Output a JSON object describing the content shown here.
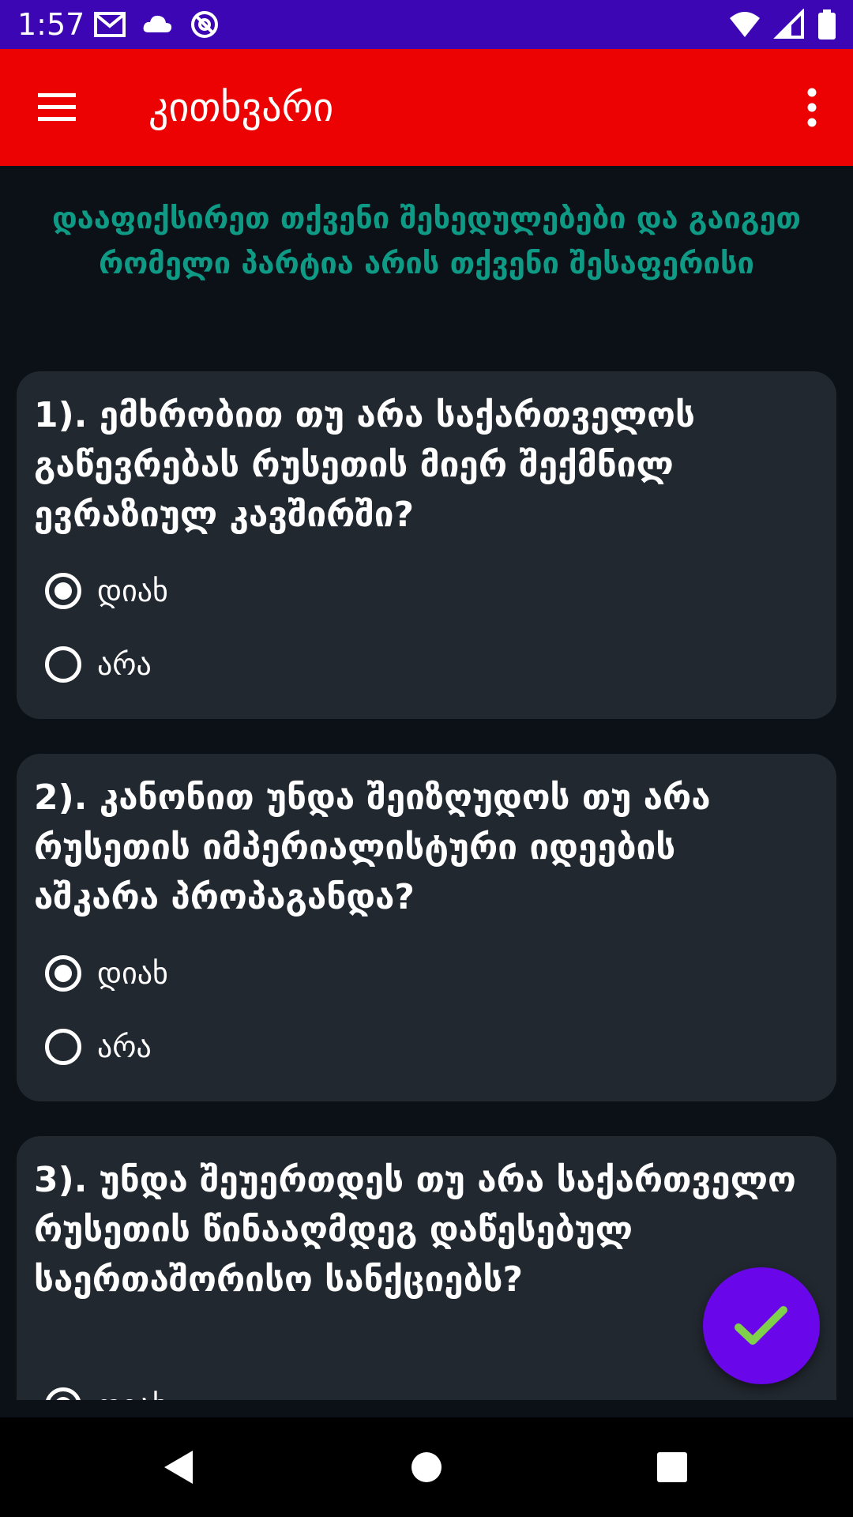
{
  "status_bar": {
    "time": "1:57",
    "icons_left": [
      "gmail-icon",
      "cloud-icon",
      "at-sign-icon"
    ],
    "icons_right": [
      "wifi-icon",
      "signal-icon",
      "battery-icon"
    ]
  },
  "app_bar": {
    "title": "კითხვარი",
    "menu_icon": "hamburger-menu-icon",
    "more_icon": "more-vertical-icon",
    "color": "#ec0202"
  },
  "subtitle": "დააფიქსირეთ თქვენი შეხედულებები და გაიგეთ რომელი პარტია არის თქვენი შესაფერისი",
  "questions": [
    {
      "text": "1). ემხრობით თუ არა საქართველოს გაწევრებას რუსეთის მიერ შექმნილ ევრაზიულ კავშირში?",
      "options": [
        "დიახ",
        "არა"
      ],
      "selected": "დიახ"
    },
    {
      "text": "2). კანონით უნდა შეიზღუდოს თუ არა რუსეთის იმპერიალისტური იდეების აშკარა პროპაგანდა?",
      "options": [
        "დიახ",
        "არა"
      ],
      "selected": "დიახ"
    },
    {
      "text": "3). უნდა შეუერთდეს თუ არა საქართველო რუსეთის წინააღმდეგ დაწესებულ საერთაშორისო სანქციებს?",
      "options": [
        "დიახ"
      ],
      "selected": "დიახ"
    }
  ],
  "fab": {
    "icon": "checkmark-icon",
    "color": "#6a06ea"
  },
  "nav_bar": {
    "icons": [
      "back-icon",
      "home-icon",
      "recents-icon"
    ]
  },
  "colors": {
    "background": "#0b1117",
    "card": "#222830",
    "subtitle_text": "#0f9a86",
    "status_bar": "#3d06b4"
  }
}
